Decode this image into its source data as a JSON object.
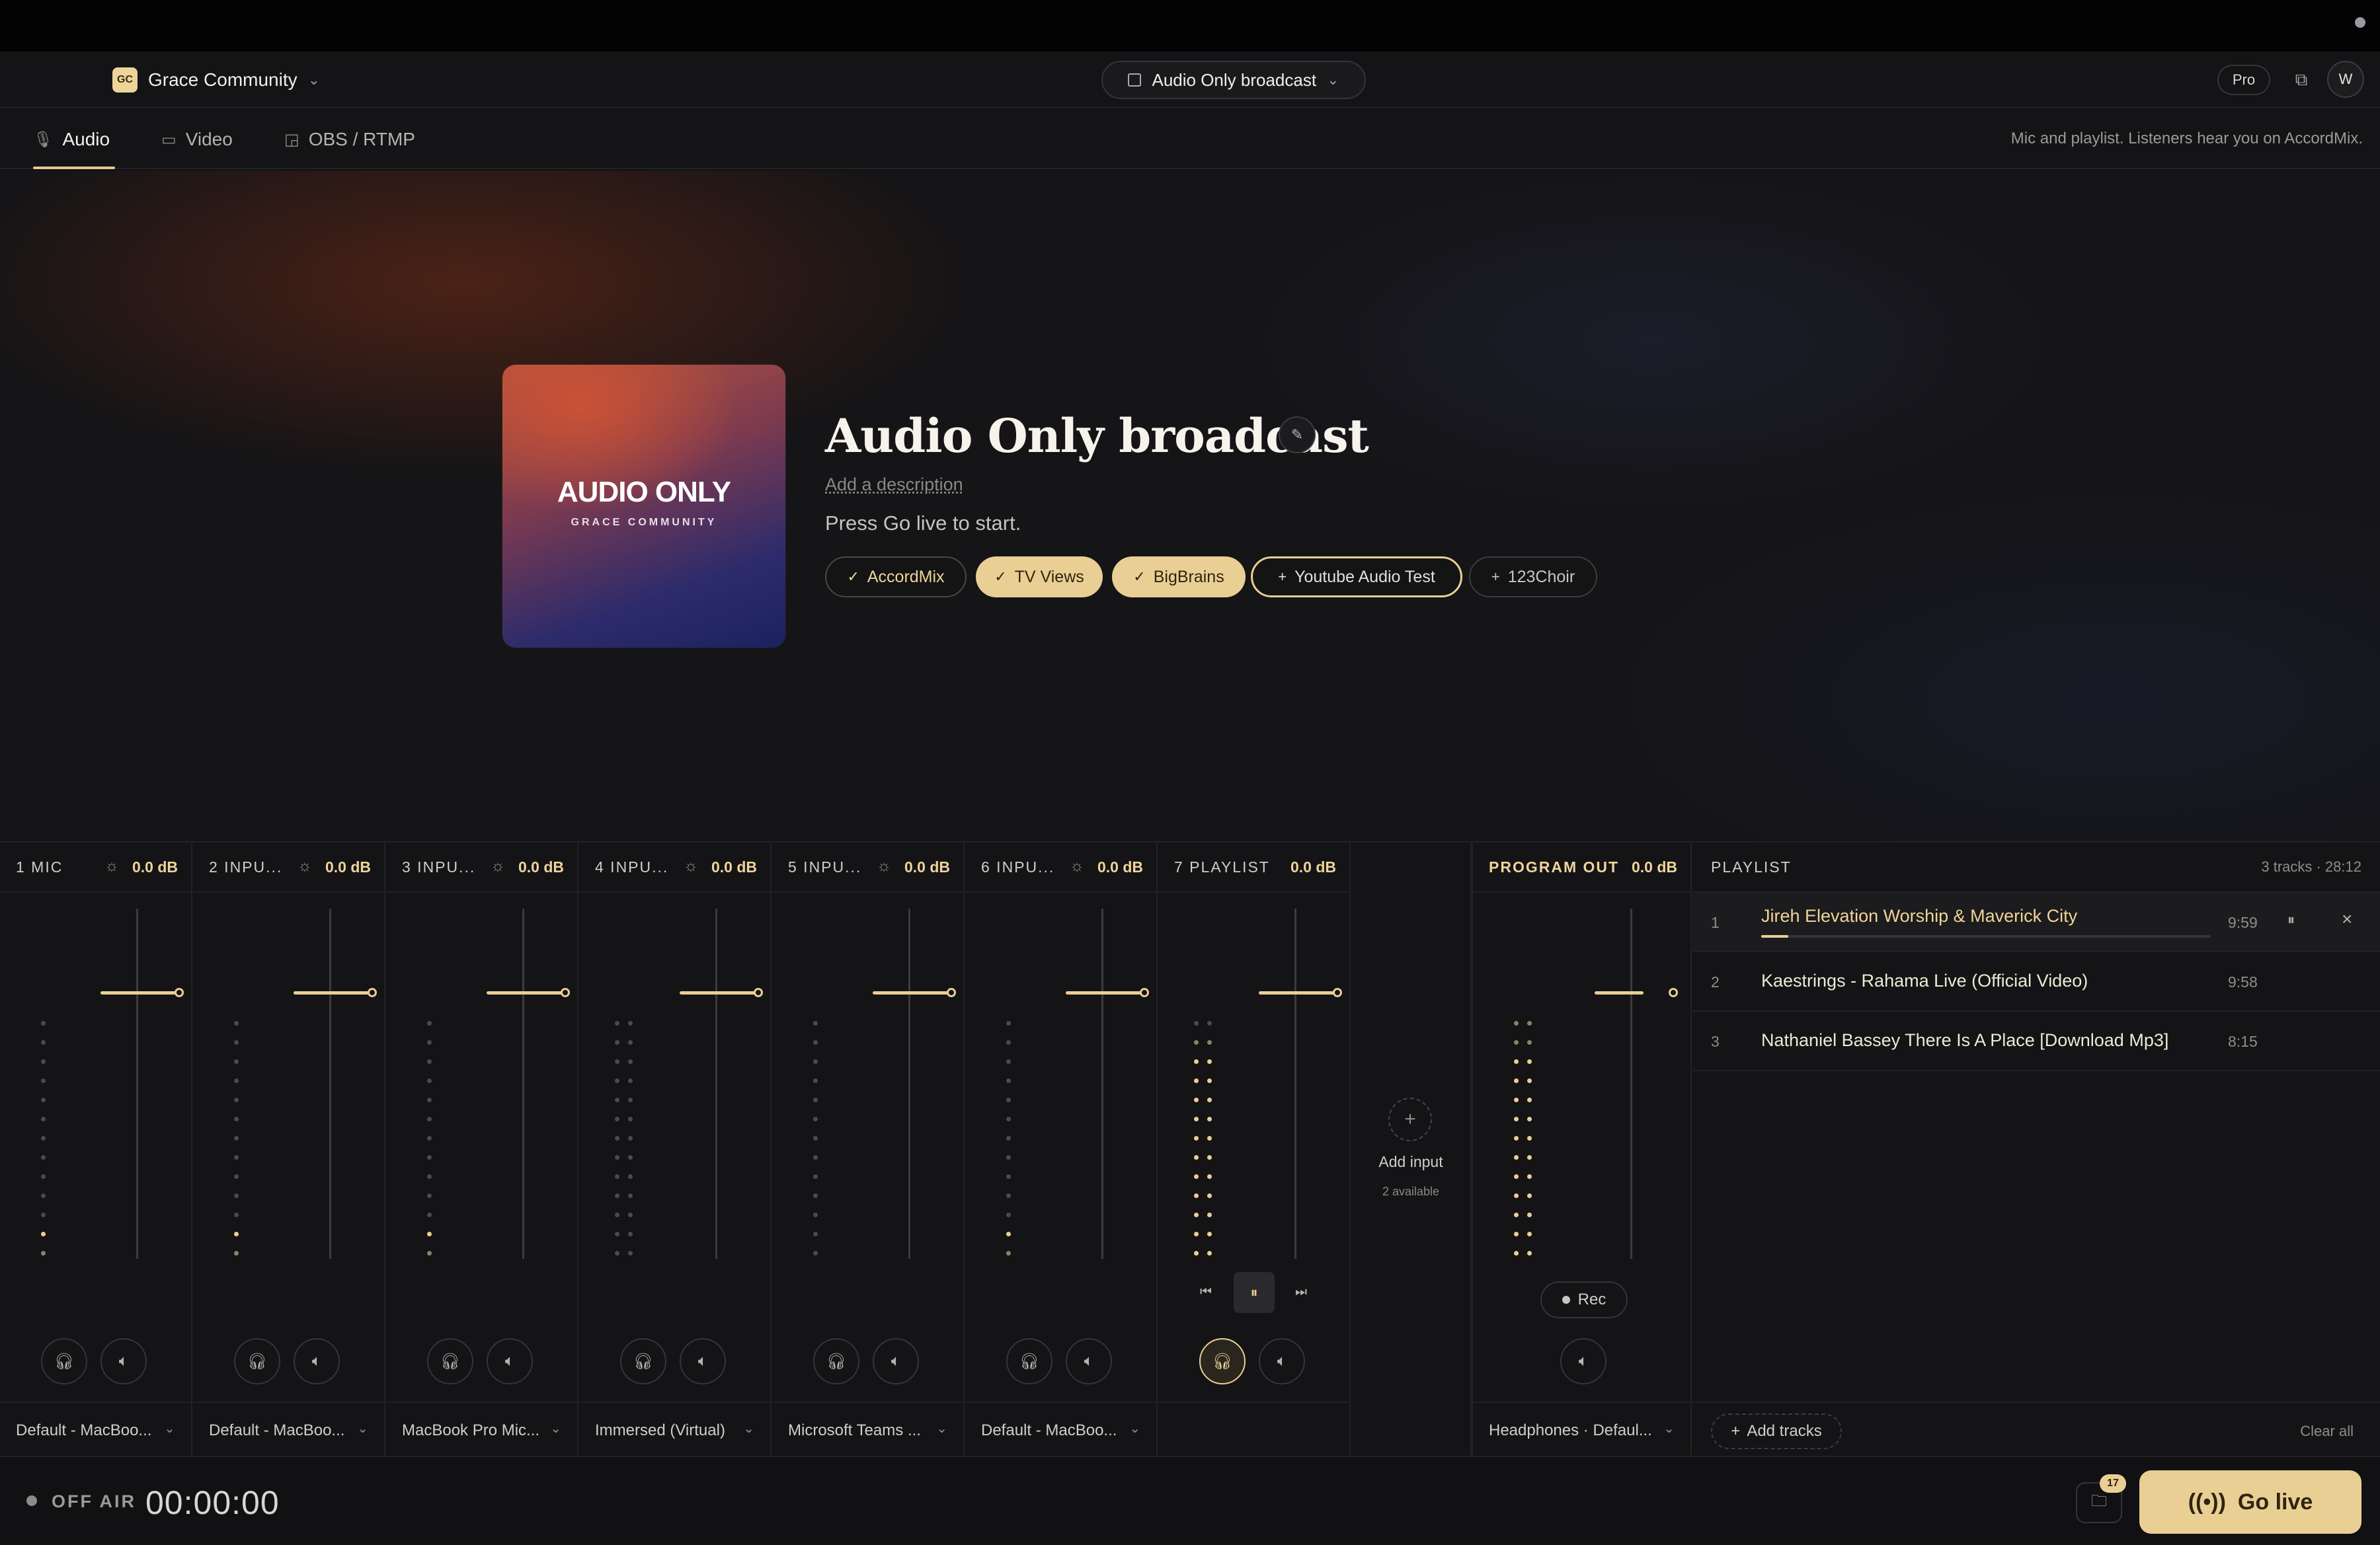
{
  "header": {
    "org_badge": "GC",
    "org_name": "Grace Community",
    "broadcast_select": "Audio Only broadcast",
    "pro_label": "Pro",
    "avatar": "W"
  },
  "tabs": [
    {
      "label": "Audio",
      "icon": "mic-icon",
      "active": true
    },
    {
      "label": "Video",
      "icon": "video-icon",
      "active": false
    },
    {
      "label": "OBS / RTMP",
      "icon": "cast-icon",
      "active": false
    }
  ],
  "tab_hint": "Mic and playlist. Listeners hear you on AccordMix.",
  "hero": {
    "art_title": "AUDIO ONLY",
    "art_subtitle": "GRACE COMMUNITY",
    "title": "Audio Only broadcast",
    "description_placeholder": "Add a description",
    "status_text": "Press Go live to start.",
    "destinations": [
      {
        "label": "AccordMix",
        "state": "selected-outline"
      },
      {
        "label": "TV Views",
        "state": "selected"
      },
      {
        "label": "BigBrains",
        "state": "selected"
      },
      {
        "label": "Youtube Audio Test",
        "state": "add-highlighted"
      },
      {
        "label": "123Choir",
        "state": "add"
      }
    ]
  },
  "mixer": {
    "strips": [
      {
        "name": "1 MIC",
        "db": "0.0 dB",
        "device": "Default - MacBoo..."
      },
      {
        "name": "2 INPU...",
        "db": "0.0 dB",
        "device": "Default - MacBoo..."
      },
      {
        "name": "3 INPU...",
        "db": "0.0 dB",
        "device": "MacBook Pro Mic..."
      },
      {
        "name": "4 INPU...",
        "db": "0.0 dB",
        "device": "Immersed (Virtual)"
      },
      {
        "name": "5 INPU...",
        "db": "0.0 dB",
        "device": "Microsoft Teams ..."
      },
      {
        "name": "6 INPU...",
        "db": "0.0 dB",
        "device": "Default - MacBoo..."
      },
      {
        "name": "7 PLAYLIST",
        "db": "0.0 dB",
        "device": ""
      }
    ],
    "add_input": {
      "label": "Add input",
      "sub": "2 available"
    },
    "program_out": {
      "name": "PROGRAM OUT",
      "db": "0.0 dB",
      "rec_label": "Rec",
      "device": "Headphones · Defaul..."
    }
  },
  "playlist": {
    "title": "PLAYLIST",
    "meta": "3 tracks · 28:12",
    "tracks": [
      {
        "num": "1",
        "name": "Jireh Elevation Worship & Maverick City",
        "duration": "9:59",
        "progress": 0.06
      },
      {
        "num": "2",
        "name": "Kaestrings - Rahama Live (Official Video)",
        "duration": "9:58"
      },
      {
        "num": "3",
        "name": "Nathaniel Bassey There Is A Place [Download Mp3]",
        "duration": "8:15"
      }
    ],
    "add_tracks": "Add tracks",
    "clear_all": "Clear all"
  },
  "bottom": {
    "air_status": "OFF AIR",
    "timer": "00:00:00",
    "folder_badge": "17",
    "go_live": "Go live"
  },
  "colors": {
    "accent": "#e9cf93",
    "bg": "#141416"
  }
}
